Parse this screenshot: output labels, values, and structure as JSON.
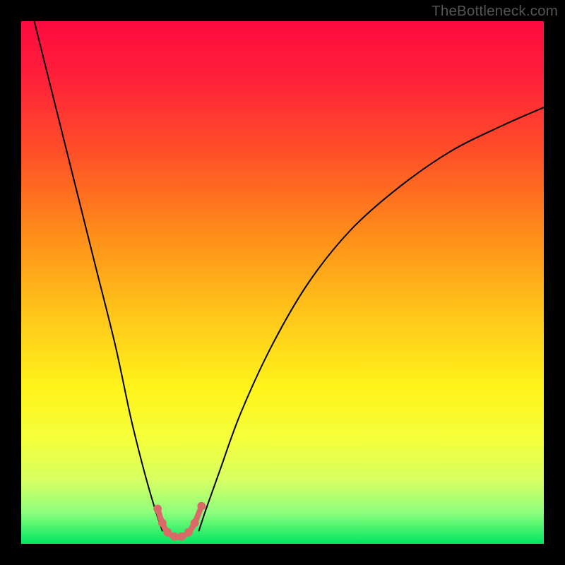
{
  "watermark": "TheBottleneck.com",
  "chart_data": {
    "type": "line",
    "title": "",
    "xlabel": "",
    "ylabel": "",
    "xlim": [
      0,
      1
    ],
    "ylim": [
      0,
      1
    ],
    "gradient_stops": [
      {
        "offset": 0.0,
        "color": "#ff0a3f"
      },
      {
        "offset": 0.1,
        "color": "#ff1e3a"
      },
      {
        "offset": 0.25,
        "color": "#ff4f28"
      },
      {
        "offset": 0.4,
        "color": "#ff8a1a"
      },
      {
        "offset": 0.55,
        "color": "#ffc21a"
      },
      {
        "offset": 0.7,
        "color": "#fff31a"
      },
      {
        "offset": 0.8,
        "color": "#f4ff3a"
      },
      {
        "offset": 0.88,
        "color": "#d6ff63"
      },
      {
        "offset": 0.94,
        "color": "#8dff7c"
      },
      {
        "offset": 1.0,
        "color": "#00e661"
      }
    ],
    "series": [
      {
        "name": "left-branch",
        "x": [
          0.025,
          0.06,
          0.1,
          0.14,
          0.18,
          0.21,
          0.235,
          0.255,
          0.27
        ],
        "y": [
          1.0,
          0.86,
          0.7,
          0.54,
          0.38,
          0.24,
          0.14,
          0.07,
          0.025
        ]
      },
      {
        "name": "right-branch",
        "x": [
          0.34,
          0.355,
          0.38,
          0.42,
          0.48,
          0.55,
          0.63,
          0.72,
          0.82,
          0.92,
          1.0
        ],
        "y": [
          0.025,
          0.07,
          0.14,
          0.25,
          0.38,
          0.5,
          0.6,
          0.68,
          0.75,
          0.8,
          0.835
        ]
      }
    ],
    "valley": {
      "name": "valley-markers",
      "color": "#d96a67",
      "points": [
        {
          "x": 0.261,
          "y": 0.067
        },
        {
          "x": 0.27,
          "y": 0.04
        },
        {
          "x": 0.28,
          "y": 0.022
        },
        {
          "x": 0.293,
          "y": 0.014
        },
        {
          "x": 0.307,
          "y": 0.014
        },
        {
          "x": 0.32,
          "y": 0.022
        },
        {
          "x": 0.332,
          "y": 0.04
        },
        {
          "x": 0.345,
          "y": 0.072
        }
      ],
      "radius": 0.008
    }
  }
}
